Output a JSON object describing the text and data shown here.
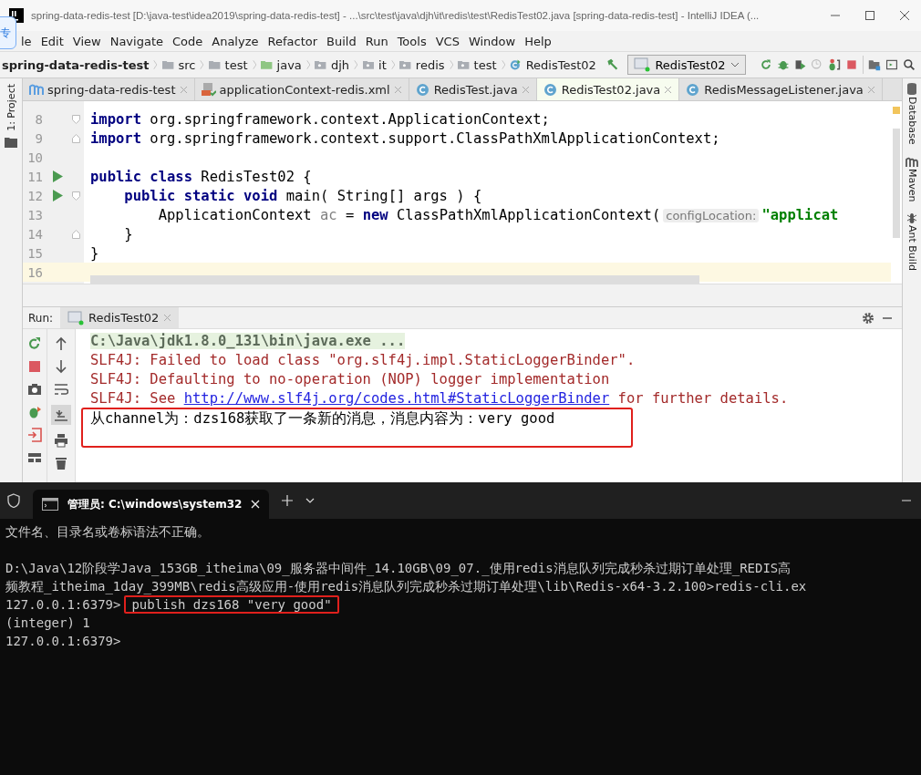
{
  "window": {
    "title": "spring-data-redis-test [D:\\java-test\\idea2019\\spring-data-redis-test] - ...\\src\\test\\java\\djh\\it\\redis\\test\\RedisTest02.java [spring-data-redis-test] - IntelliJ IDEA (...",
    "badge": "专"
  },
  "menu": [
    "le",
    "Edit",
    "View",
    "Navigate",
    "Code",
    "Analyze",
    "Refactor",
    "Build",
    "Run",
    "Tools",
    "VCS",
    "Window",
    "Help"
  ],
  "navbar": {
    "breadcrumbs": [
      {
        "label": "spring-data-redis-test",
        "kind": "project"
      },
      {
        "label": "src",
        "kind": "folder"
      },
      {
        "label": "test",
        "kind": "folder"
      },
      {
        "label": "java",
        "kind": "source"
      },
      {
        "label": "djh",
        "kind": "package"
      },
      {
        "label": "it",
        "kind": "package"
      },
      {
        "label": "redis",
        "kind": "package"
      },
      {
        "label": "test",
        "kind": "package"
      },
      {
        "label": "RedisTest02",
        "kind": "class"
      }
    ],
    "run_config": "RedisTest02"
  },
  "editor_tabs": [
    {
      "label": "spring-data-redis-test",
      "kind": "module",
      "selected": false
    },
    {
      "label": "applicationContext-redis.xml",
      "kind": "xml",
      "selected": false
    },
    {
      "label": "RedisTest.java",
      "kind": "class",
      "selected": false
    },
    {
      "label": "RedisTest02.java",
      "kind": "class",
      "selected": true
    },
    {
      "label": "RedisMessageListener.java",
      "kind": "class",
      "selected": false
    }
  ],
  "left_strip": "1: Project",
  "right_strip": [
    {
      "label": "Database",
      "kind": "database"
    },
    {
      "label": "Maven",
      "kind": "maven"
    },
    {
      "label": "Ant Build",
      "kind": "ant"
    }
  ],
  "editor": {
    "lines": [
      {
        "number": "8",
        "run": false,
        "current": false,
        "fold_start": true,
        "fold_end": false,
        "tokens": [
          {
            "kind": "keyword",
            "text": "import"
          },
          {
            "kind": "plain",
            "text": " org.springframework.context.ApplicationContext;"
          }
        ]
      },
      {
        "number": "9",
        "run": false,
        "current": false,
        "fold_start": false,
        "fold_end": true,
        "tokens": [
          {
            "kind": "keyword",
            "text": "import"
          },
          {
            "kind": "plain",
            "text": " org.springframework.context.support.ClassPathXmlApplicationContext;"
          }
        ]
      },
      {
        "number": "10",
        "run": false,
        "current": false,
        "fold_start": false,
        "fold_end": false
      },
      {
        "number": "11",
        "run": true,
        "current": false,
        "fold_start": false,
        "fold_end": false,
        "tokens": [
          {
            "kind": "keyword",
            "text": "public class"
          },
          {
            "kind": "plain",
            "text": " RedisTest02 {"
          }
        ]
      },
      {
        "number": "12",
        "run": true,
        "current": false,
        "fold_start": true,
        "fold_end": false,
        "tokens": [
          {
            "kind": "keyword",
            "text": "    public static void"
          },
          {
            "kind": "plain",
            "text": " main( String[] args ) {"
          }
        ]
      },
      {
        "number": "13",
        "run": false,
        "current": false,
        "fold_start": false,
        "fold_end": false,
        "tokens": [
          {
            "kind": "plain",
            "text": "        ApplicationContext "
          },
          {
            "kind": "unused",
            "text": "ac"
          },
          {
            "kind": "plain",
            "text": " = "
          },
          {
            "kind": "keyword",
            "text": "new"
          },
          {
            "kind": "plain",
            "text": " ClassPathXmlApplicationContext("
          },
          {
            "kind": "hint",
            "text": "configLocation:"
          },
          {
            "kind": "string",
            "text": "\"applicat"
          }
        ]
      },
      {
        "number": "14",
        "run": false,
        "current": false,
        "fold_start": false,
        "fold_end": true,
        "tokens": [
          {
            "kind": "plain",
            "text": "    }"
          }
        ]
      },
      {
        "number": "15",
        "run": false,
        "current": false,
        "fold_start": false,
        "fold_end": false,
        "tokens": [
          {
            "kind": "plain",
            "text": "}"
          }
        ]
      },
      {
        "number": "16",
        "run": false,
        "current": true,
        "fold_start": false,
        "fold_end": false
      }
    ]
  },
  "run": {
    "label": "Run:",
    "tab": "RedisTest02",
    "output": [
      {
        "kind": "command",
        "highlighted": false,
        "segments": [
          {
            "text": "C:\\Java\\jdk1.8.0_131\\bin\\java.exe ...",
            "link": false
          }
        ]
      },
      {
        "kind": "error",
        "highlighted": false,
        "segments": [
          {
            "text": "SLF4J: Failed to load class \"org.slf4j.impl.StaticLoggerBinder\".",
            "link": false
          }
        ]
      },
      {
        "kind": "error",
        "highlighted": false,
        "segments": [
          {
            "text": "SLF4J: Defaulting to no-operation (NOP) logger implementation",
            "link": false
          }
        ]
      },
      {
        "kind": "error",
        "highlighted": false,
        "segments": [
          {
            "text": "SLF4J: See ",
            "link": false
          },
          {
            "text": "http://www.slf4j.org/codes.html#StaticLoggerBinder",
            "link": true
          },
          {
            "text": " for further details.",
            "link": false
          }
        ]
      },
      {
        "kind": "normal",
        "highlighted": true,
        "segments": [
          {
            "text": "从channel为：dzs168获取了一条新的消息，消息内容为：very good",
            "link": false
          }
        ]
      }
    ]
  },
  "terminal": {
    "tab": "管理员: C:\\windows\\system32",
    "lines": [
      {
        "kind": "text",
        "segments": [
          {
            "text": "文件名、目录名或卷标语法不正确。",
            "highlighted": false
          }
        ]
      },
      {
        "kind": "blank"
      },
      {
        "kind": "text",
        "segments": [
          {
            "text": "D:\\Java\\12阶段学Java_153GB_itheima\\09_服务器中间件_14.10GB\\09_07._使用redis消息队列完成秒杀过期订单处理_REDIS高",
            "highlighted": false
          }
        ]
      },
      {
        "kind": "text",
        "segments": [
          {
            "text": "频教程_itheima_1day_399MB\\redis高级应用-使用redis消息队列完成秒杀过期订单处理\\lib\\Redis-x64-3.2.100>redis-cli.ex",
            "highlighted": false
          }
        ]
      },
      {
        "kind": "text",
        "segments": [
          {
            "text": "127.0.0.1:6379>",
            "highlighted": false
          },
          {
            "text": "publish dzs168 \"very good\"",
            "highlighted": true
          }
        ]
      },
      {
        "kind": "text",
        "segments": [
          {
            "text": "(integer) 1",
            "highlighted": false
          }
        ]
      },
      {
        "kind": "text",
        "segments": [
          {
            "text": "127.0.0.1:6379>",
            "highlighted": false
          }
        ]
      }
    ]
  }
}
